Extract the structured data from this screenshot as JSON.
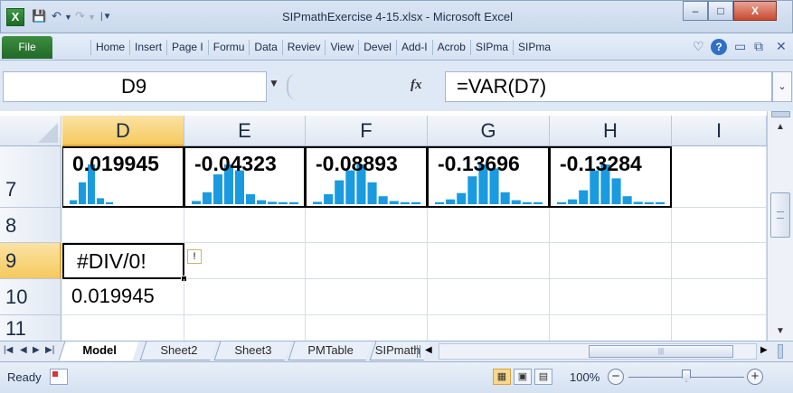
{
  "window": {
    "title": "SIPmathExercise 4-15.xlsx  -  Microsoft Excel",
    "app_icon": "X",
    "minimize": "–",
    "maximize": "□",
    "close": "X"
  },
  "ribbon": {
    "file_tab": "File",
    "tabs": [
      "Home",
      "Insert",
      "Page I",
      "Formu",
      "Data",
      "Reviev",
      "View",
      "Devel",
      "Add-I",
      "Acrob",
      "SIPma",
      "SIPma"
    ]
  },
  "formula_bar": {
    "name_box": "D9",
    "fx": "fx",
    "formula": "=VAR(D7)"
  },
  "grid": {
    "columns": [
      "D",
      "E",
      "F",
      "G",
      "H",
      "I"
    ],
    "selected_column": "D",
    "rows": [
      "7",
      "8",
      "9",
      "10",
      "11"
    ],
    "selected_row": "9",
    "row7": {
      "D": "0.019945",
      "E": "-0.04323",
      "F": "-0.08893",
      "G": "-0.13696",
      "H": "-0.13284"
    },
    "D9": "#DIV/0!",
    "D10": "0.019945",
    "error_tag": "!"
  },
  "sparklines": {
    "color": "#1a9be0",
    "D": [
      0.1,
      0.55,
      1.0,
      0.15,
      0.05
    ],
    "E": [
      0.08,
      0.3,
      0.75,
      1.0,
      0.85,
      0.25,
      0.1,
      0.06,
      0.05,
      0.05
    ],
    "F": [
      0.06,
      0.25,
      0.6,
      0.85,
      1.0,
      0.55,
      0.2,
      0.08,
      0.05,
      0.05
    ],
    "G": [
      0.05,
      0.12,
      0.28,
      0.7,
      1.0,
      0.9,
      0.3,
      0.1,
      0.05,
      0.05
    ],
    "H": [
      0.05,
      0.12,
      0.35,
      0.85,
      1.0,
      0.65,
      0.2,
      0.06,
      0.05,
      0.05
    ]
  },
  "sheets": {
    "tabs": [
      "Model",
      "Sheet2",
      "Sheet3",
      "PMTable",
      "SIPmath Cha"
    ],
    "active": "Model"
  },
  "status": {
    "ready": "Ready",
    "zoom": "100%"
  }
}
